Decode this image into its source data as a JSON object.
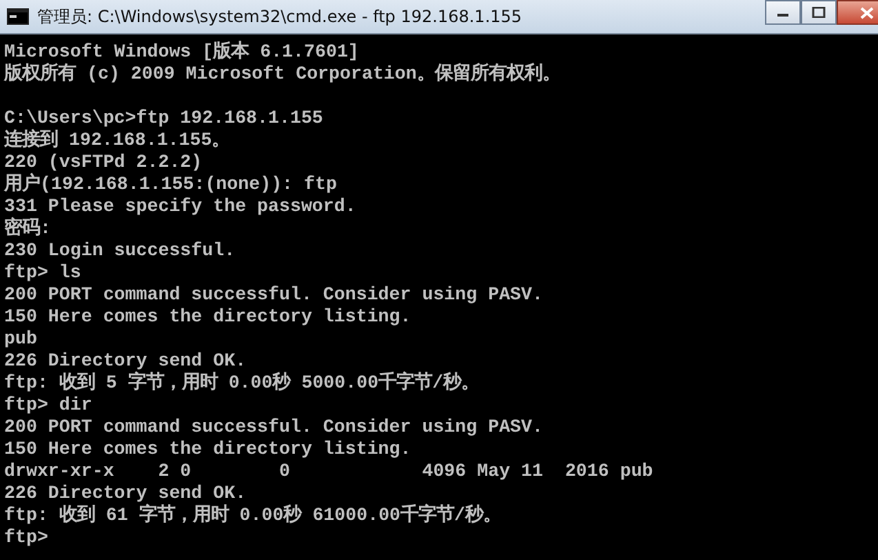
{
  "window": {
    "title": "管理员: C:\\Windows\\system32\\cmd.exe - ftp  192.168.1.155"
  },
  "console": {
    "blocks": [
      [
        "Microsoft Windows [版本 6.1.7601]",
        "版权所有 (c) 2009 Microsoft Corporation。保留所有权利。"
      ],
      [
        "C:\\Users\\pc>ftp 192.168.1.155",
        "连接到 192.168.1.155。",
        "220 (vsFTPd 2.2.2)",
        "用户(192.168.1.155:(none)): ftp",
        "331 Please specify the password.",
        "密码:",
        "230 Login successful.",
        "ftp> ls",
        "200 PORT command successful. Consider using PASV.",
        "150 Here comes the directory listing.",
        "pub",
        "226 Directory send OK.",
        "ftp: 收到 5 字节，用时 0.00秒 5000.00千字节/秒。",
        "ftp> dir",
        "200 PORT command successful. Consider using PASV.",
        "150 Here comes the directory listing.",
        "drwxr-xr-x    2 0        0            4096 May 11  2016 pub",
        "226 Directory send OK.",
        "ftp: 收到 61 字节，用时 0.00秒 61000.00千字节/秒。",
        "ftp>"
      ]
    ]
  }
}
